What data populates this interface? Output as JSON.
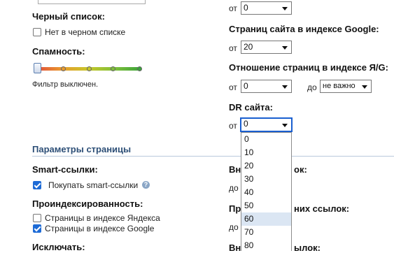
{
  "left": {
    "blacklist": {
      "title": "Черный список:",
      "checkbox_label": "Нет в черном списке",
      "checked": false
    },
    "spam": {
      "title": "Спамность:",
      "filter_status": "Фильтр выключен."
    }
  },
  "right": {
    "first_select": {
      "from_label": "от",
      "value": "0"
    },
    "google_pages": {
      "title": "Страниц сайта в индексе Google:",
      "from_label": "от",
      "value": "20"
    },
    "ratio": {
      "title": "Отношение страниц в индексе Я/G:",
      "from_label": "от",
      "from_value": "0",
      "to_label": "до",
      "to_value": "не важно"
    },
    "dr": {
      "title": "DR сайта:",
      "from_label": "от",
      "value": "0",
      "options": [
        "0",
        "10",
        "20",
        "30",
        "40",
        "50",
        "60",
        "70",
        "80"
      ],
      "hover_option": "60"
    }
  },
  "page_params": {
    "section_title": "Параметры страницы",
    "smart_links": {
      "title": "Smart-ссылки:",
      "checkbox_label": "Покупать smart-ссылки",
      "checked": true
    },
    "indexed": {
      "title": "Проиндексированность:",
      "yandex_label": "Страницы в индексе Яндекса",
      "yandex_checked": false,
      "google_label": "Страницы в индексе Google",
      "google_checked": true
    },
    "exclude": {
      "title": "Исключать:"
    },
    "partial_right": {
      "label1": "Вн",
      "label1_suffix": "ок:",
      "do1": "до",
      "label2": "Пр",
      "label2_suffix": "них ссылок:",
      "do2": "до",
      "label3": "Вн",
      "label3_suffix": "ылок:"
    }
  },
  "icons": {
    "help": "help-icon",
    "checkmark": "checkmark-icon",
    "dropdown_arrow": "chevron-down-icon"
  }
}
